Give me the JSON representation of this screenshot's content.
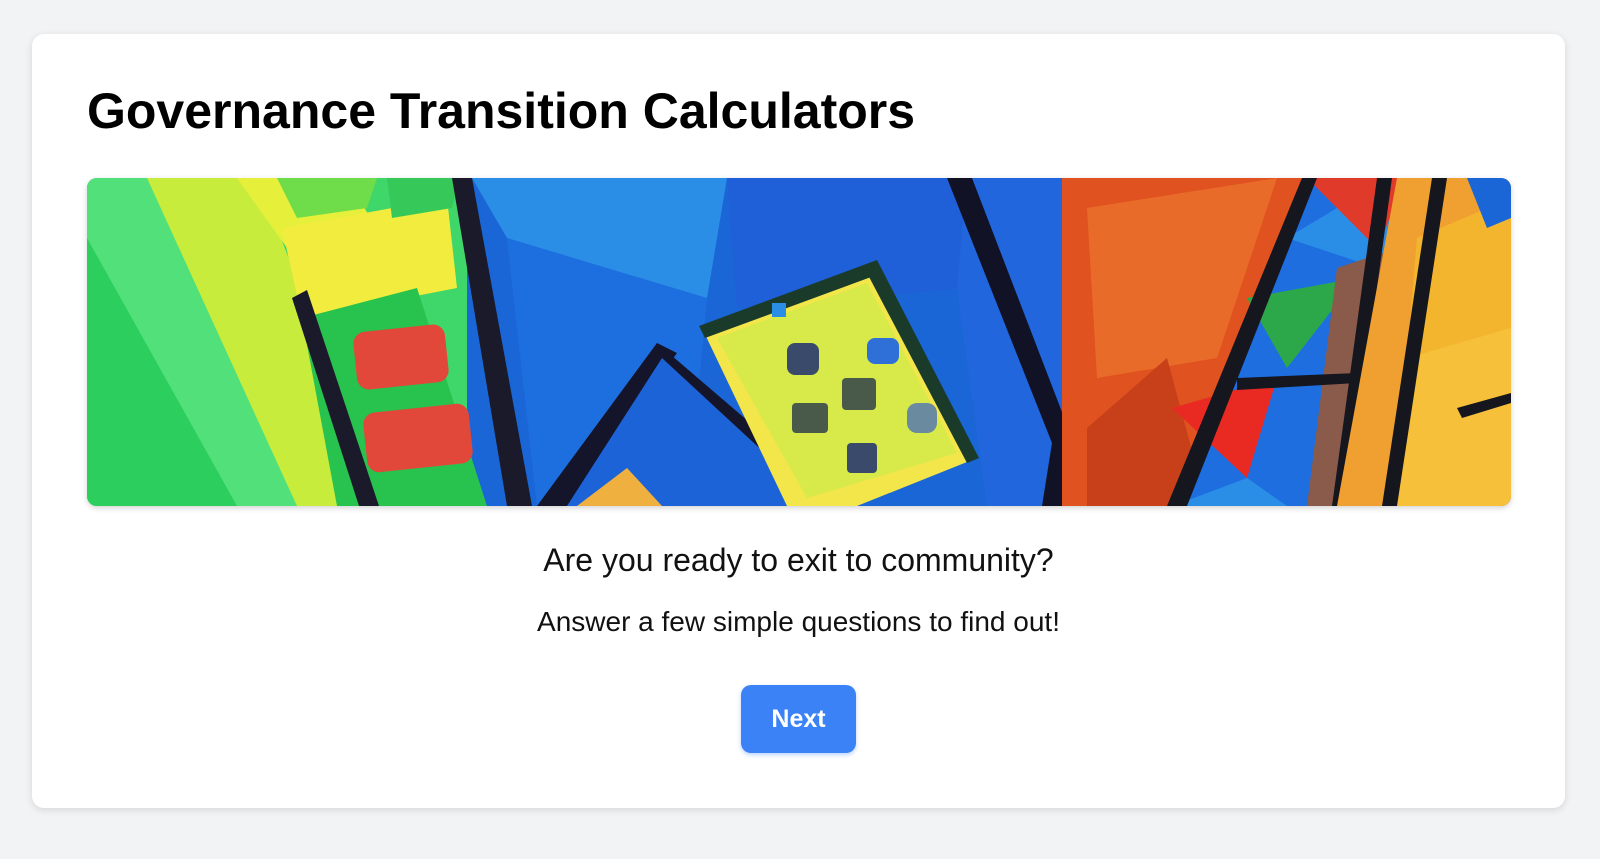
{
  "page": {
    "title": "Governance Transition Calculators",
    "question": "Are you ready to exit to community?",
    "instruction": "Answer a few simple questions to find out!",
    "next_label": "Next"
  },
  "colors": {
    "page_background": "#f2f3f5",
    "card_background": "#ffffff",
    "accent": "#3b82f6",
    "button_text": "#ffffff"
  },
  "hero_image": {
    "description_icon": "abstract-painting-image"
  }
}
